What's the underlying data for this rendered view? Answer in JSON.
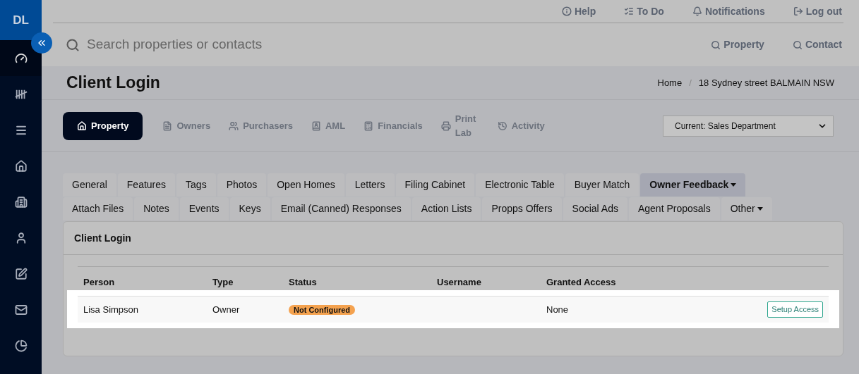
{
  "sidebar": {
    "logo": "DL",
    "items": [
      {
        "selected": true
      },
      {
        "selected": false
      },
      {
        "selected": false
      },
      {
        "selected": false
      },
      {
        "selected": false
      },
      {
        "selected": false
      },
      {
        "selected": false
      },
      {
        "selected": false
      },
      {
        "selected": false
      }
    ]
  },
  "top_links": [
    "Help",
    "To Do",
    "Notifications",
    "Log out"
  ],
  "search": {
    "placeholder": "Search properties or contacts",
    "buttons": [
      "Property",
      "Contact"
    ]
  },
  "page": {
    "title": "Client Login",
    "breadcrumb": [
      "Home",
      "18 Sydney street BALMAIN NSW"
    ],
    "breadcrumb_separator": "/"
  },
  "nav_tabs": [
    {
      "label": "Property",
      "selected": true
    },
    {
      "label": "Owners",
      "selected": false
    },
    {
      "label": "Purchasers",
      "selected": false
    },
    {
      "label": "AML",
      "selected": false
    },
    {
      "label": "Financials",
      "selected": false
    },
    {
      "label": "Print Lab",
      "selected": false
    },
    {
      "label": "Activity",
      "selected": false
    }
  ],
  "department_select": {
    "value": "Current: Sales Department"
  },
  "sub_tabs": [
    [
      {
        "label": "General",
        "selected": false,
        "dropdown": false
      },
      {
        "label": "Features",
        "selected": false,
        "dropdown": false
      },
      {
        "label": "Tags",
        "selected": false,
        "dropdown": false
      },
      {
        "label": "Photos",
        "selected": false,
        "dropdown": false
      },
      {
        "label": "Open Homes",
        "selected": false,
        "dropdown": false
      },
      {
        "label": "Letters",
        "selected": false,
        "dropdown": false
      },
      {
        "label": "Filing Cabinet",
        "selected": false,
        "dropdown": false
      },
      {
        "label": "Electronic Table",
        "selected": false,
        "dropdown": false
      },
      {
        "label": "Buyer Match",
        "selected": false,
        "dropdown": false
      },
      {
        "label": "Owner Feedback",
        "selected": true,
        "dropdown": true
      }
    ],
    [
      {
        "label": "Attach Files",
        "selected": false,
        "dropdown": false
      },
      {
        "label": "Notes",
        "selected": false,
        "dropdown": false
      },
      {
        "label": "Events",
        "selected": false,
        "dropdown": false
      },
      {
        "label": "Keys",
        "selected": false,
        "dropdown": false
      },
      {
        "label": "Email (Canned) Responses",
        "selected": false,
        "dropdown": false
      },
      {
        "label": "Action Lists",
        "selected": false,
        "dropdown": false
      },
      {
        "label": "Propps Offers",
        "selected": false,
        "dropdown": false
      },
      {
        "label": "Social Ads",
        "selected": false,
        "dropdown": false
      },
      {
        "label": "Agent Proposals",
        "selected": false,
        "dropdown": false
      },
      {
        "label": "Other",
        "selected": false,
        "dropdown": true
      }
    ]
  ],
  "panel": {
    "title": "Client Login",
    "table": {
      "columns": [
        "Person",
        "Type",
        "Status",
        "Username",
        "Granted Access"
      ],
      "rows": [
        {
          "person": "Lisa Simpson",
          "type": "Owner",
          "status": {
            "label": "Not Configured",
            "color": "#f4a24f"
          },
          "granted_access": "None",
          "action": "Setup Access",
          "highlighted": true
        }
      ]
    }
  }
}
